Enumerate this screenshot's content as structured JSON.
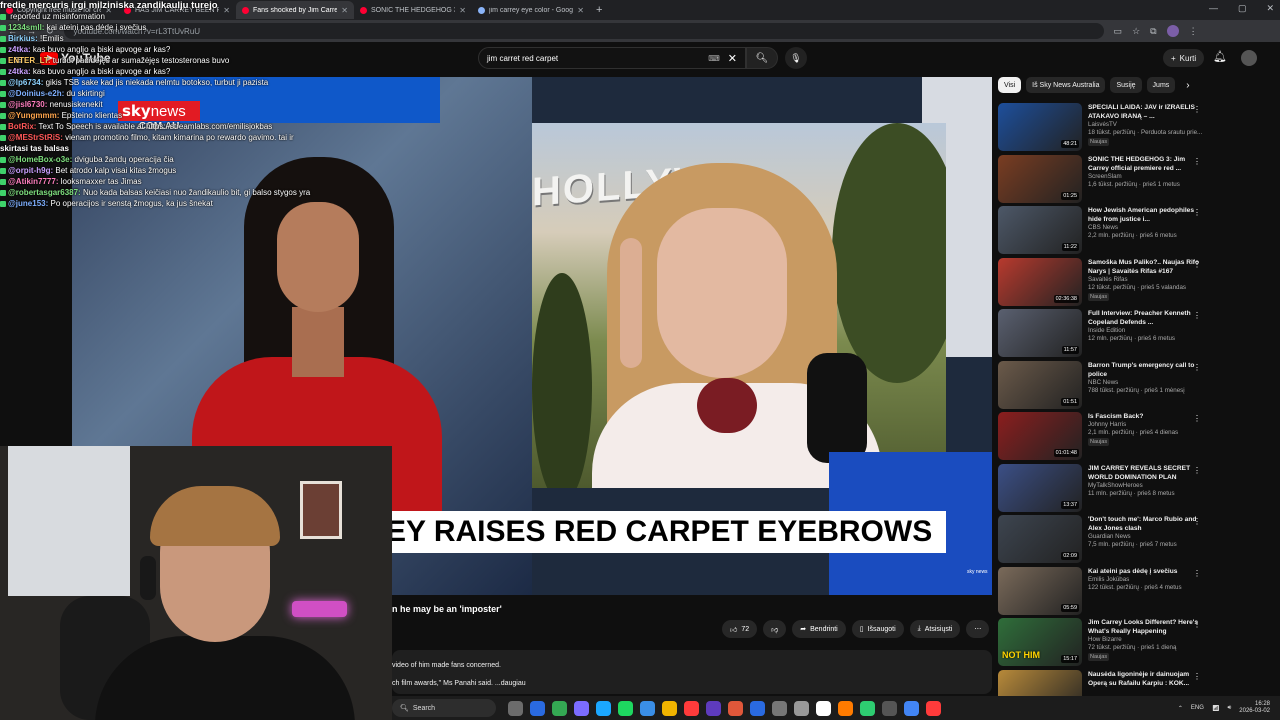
{
  "browser": {
    "tabs": [
      {
        "title": "Copyright free music for creators",
        "fav": "yt"
      },
      {
        "title": "HAS JIM CARREY BEEN REPLACED",
        "fav": "yt"
      },
      {
        "title": "Fans shocked by Jim Carrey",
        "fav": "yt",
        "active": true
      },
      {
        "title": "SONIC THE HEDGEHOG 3: Jim",
        "fav": "yt"
      },
      {
        "title": "jim carrey eye color - Google",
        "fav": "g"
      }
    ],
    "new_tab": "+",
    "url": "youtube.com/watch?v=rL3TtUvRuU"
  },
  "youtube": {
    "logo_text": "YouTube",
    "search_value": "jim carret red carpet",
    "create_label": "Kurti"
  },
  "chat": [
    {
      "user": "fredie mercuris irgi milziniska zandikaulju turejo",
      "msg": "",
      "color": "#ffffff",
      "first": true
    },
    {
      "user": "",
      "msg": "reported uz misinformation",
      "color": "#ffffff"
    },
    {
      "user": "1234smll:",
      "msg": "kai ateini pas dėdę į svečius",
      "color": "#7fe07f"
    },
    {
      "user": "Birkius:",
      "msg": "!Emilis",
      "color": "#8fd3ff"
    },
    {
      "user": "z4tka:",
      "msg": "kas buvo angljo a biski apvoge ar kas?",
      "color": "#c9a0ff"
    },
    {
      "user": "ENTER_LT:",
      "msg": "turbut padidėjęs ar sumažėjęs testosteronas buvo",
      "color": "#ffcc66"
    },
    {
      "user": "z4tka:",
      "msg": "kas buvo angljo a biski apvoge ar kas?",
      "color": "#c9a0ff"
    },
    {
      "user": "@lp6734:",
      "msg": "gikis TSB sake kad jis niekada nelmtu botokso, turbut ji pazista",
      "color": "#8fd3ff"
    },
    {
      "user": "@Doinius-e2h:",
      "msg": "du skirtingi",
      "color": "#7fb0ff"
    },
    {
      "user": "@jisl6730:",
      "msg": "nenusiskenekit",
      "color": "#ff7fbf"
    },
    {
      "user": "@Yungmmm:",
      "msg": "Epšteino klientas",
      "color": "#ffa64d"
    },
    {
      "user": "BotRix:",
      "msg": "Text To Speech is available at https://streamlabs.com/emilisjokbas",
      "color": "#ff5959"
    },
    {
      "user": "@MEStrStRiS:",
      "msg": "vienam promotino filmo, kitam kimarina po rewardo gavimo. tai ir",
      "color": "#ff5959"
    },
    {
      "user": "skirtasi tas balsas",
      "msg": "",
      "color": "#ffffff"
    },
    {
      "user": "@HomeBox-o3e:",
      "msg": "dviguba žandų operacija čia",
      "color": "#7fe07f"
    },
    {
      "user": "@orpit-h9g:",
      "msg": "Bet atrodo kalp visai kitas žmogus",
      "color": "#c9a0ff"
    },
    {
      "user": "@Atikin7777:",
      "msg": "looksmaxxer tas Jimas",
      "color": "#ff7fbf"
    },
    {
      "user": "@robertasgar6387:",
      "msg": "Nuo kada balsas keičiasi nuo žandikaulio bit, gi balso stygos yra",
      "color": "#7fe07f"
    },
    {
      "user": "@june153:",
      "msg": "Po operacijos ir senstą žmogus, ka jus šnekat",
      "color": "#7fb0ff"
    }
  ],
  "video": {
    "logo_top": "sky",
    "logo_top2": "news",
    "logo_bottom": ".COM.AU",
    "banner_text": "EY RAISES RED CARPET EYEBROWS",
    "hollywood_text": "HOLLYWO",
    "sky_bug": "sky news",
    "title_fragment": "n he may be an 'imposter'",
    "likes": "72",
    "share_label": "Bendrinti",
    "save_label": "Išsaugoti",
    "download_label": "Atsisiųsti",
    "desc_line1": "video of him made fans concerned.",
    "desc_line2": "ch film awards,\" Ms Panahi said.",
    "desc_more": "...daugiau"
  },
  "sidebar": {
    "chips": [
      "Visi",
      "Iš Sky News Australia",
      "Susiję",
      "Jums"
    ],
    "items": [
      {
        "title": "SPECIALI LAIDA: JAV ir IZRAELIS ATAKAVO IRANĄ – ...",
        "channel": "LaisvėsTV",
        "views": "18 tūkst. peržiūrų · Perduota srautu prie...",
        "dur": "48:21",
        "badge": "Naujas",
        "thumb": "#1d4f9c"
      },
      {
        "title": "SONIC THE HEDGEHOG 3: Jim Carrey official premiere red ...",
        "channel": "ScreenSlam",
        "views": "1,6 tūkst. peržiūrų · prieš 1 metus",
        "dur": "01:25",
        "badge": "",
        "thumb": "#7a3d22"
      },
      {
        "title": "How Jewish American pedophiles hide from justice i...",
        "channel": "CBS News",
        "views": "2,2 mln. peržiūrų · prieš 6 metus",
        "dur": "11:22",
        "badge": "",
        "thumb": "#4d5868"
      },
      {
        "title": "Samoška Mus Paliko?.. Naujas Rifo Narys | Savaitės Rifas #167",
        "channel": "Savaitės Rifas",
        "views": "12 tūkst. peržiūrų · prieš 5 valandas",
        "dur": "02:36:38",
        "badge": "Naujas",
        "thumb": "#b83a2e"
      },
      {
        "title": "Full Interview: Preacher Kenneth Copeland Defends ...",
        "channel": "Inside Edition",
        "views": "12 mln. peržiūrų · prieš 6 metus",
        "dur": "11:57",
        "badge": "",
        "thumb": "#5a6070"
      },
      {
        "title": "Barron Trump's emergency call to police",
        "channel": "NBC News",
        "views": "788 tūkst. peržiūrų · prieš 1 mėnesį",
        "dur": "01:51",
        "badge": "",
        "thumb": "#6b5a4a"
      },
      {
        "title": "Is Fascism Back?",
        "channel": "Johnny Harris",
        "views": "2,1 mln. peržiūrų · prieš 4 dienas",
        "dur": "01:01:48",
        "badge": "Naujas",
        "thumb": "#8b1e1e"
      },
      {
        "title": "JIM CARREY REVEALS SECRET WORLD DOMINATION PLAN",
        "channel": "MyTalkShowHeroes",
        "views": "11 mln. peržiūrų · prieš 8 metus",
        "dur": "13:37",
        "badge": "",
        "thumb": "#3b4f86"
      },
      {
        "title": "'Don't touch me': Marco Rubio and Alex Jones clash",
        "channel": "Guardian News",
        "views": "7,5 mln. peržiūrų · prieš 7 metus",
        "dur": "02:09",
        "badge": "",
        "thumb": "#3d4550"
      },
      {
        "title": "Kai ateini pas dėdę į svečius",
        "channel": "Emilis Jokūbas",
        "views": "122 tūkst. peržiūrų · prieš 4 metus",
        "dur": "05:59",
        "badge": "",
        "thumb": "#7a6a5a"
      },
      {
        "title": "Jim Carrey Looks Different? Here's What's Really Happening",
        "channel": "How Bizarre",
        "views": "72 tūkst. peržiūrų · prieš 1 dieną",
        "dur": "15:17",
        "badge": "Naujas",
        "thumb": "#2f6e3a",
        "overlay": "NOT HIM"
      },
      {
        "title": "Nausėda ligoninėje ir dainuojam Operą su Rafailu Karpiu : KOK...",
        "channel": "",
        "views": "",
        "dur": "",
        "badge": "",
        "thumb": "#b88a3a"
      }
    ]
  },
  "taskbar": {
    "search_label": "Search",
    "lang": "ENG",
    "time": "16:28",
    "date": "2026-03-02",
    "icon_colors": [
      "#6c6c6c",
      "#2a6ae0",
      "#34a853",
      "#7b6cff",
      "#1ba7ff",
      "#1ed760",
      "#3a8ee6",
      "#f0b400",
      "#ff3b3b",
      "#5e3bbd",
      "#e0573a",
      "#2a6ae0",
      "#777",
      "#999",
      "#fff",
      "#ff7b00",
      "#2ecc71",
      "#555",
      "#4285f4",
      "#ff3b3b"
    ]
  }
}
